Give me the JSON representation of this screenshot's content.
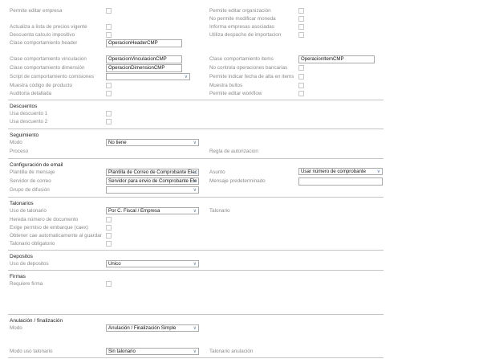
{
  "top": {
    "permite_editar_empresa": "Permite editar empresa",
    "actualiza_lista_precios": "Actualiza a lista de precios vigente",
    "descuenta_calculo_impositivo": "Descuenta calculo impositivo",
    "clase_comportamiento_header": "Clase comportamiento header",
    "clase_comportamiento_header_value": "OperacionHeaderCMP",
    "permite_editar_organizacion": "Permite editar organización",
    "no_permite_modificar_moneda": "No permite modificar moneda",
    "informa_empresas_asociadas": "Informa empresas asociadas",
    "utiliza_despacho_importacion": "Utiliza despacho de importacion"
  },
  "comportamiento": {
    "vinculacion_label": "Clase comportamiento vinculacion",
    "vinculacion_value": "OperacionVinculacionCMP",
    "dimension_label": "Clase comportamiento dimensión",
    "dimension_value": "OperacionDimensionCMP",
    "script_label": "Script de comportamiento comisiones",
    "script_value": "",
    "muestra_codigo_producto": "Muestra código de producto",
    "auditoria_detallada": "Auditoria detallada",
    "items_label": "Clase comportamiento items",
    "items_value": "OperacionItemCMP",
    "no_controla_operaciones_bancarias": "No controla operaciones bancarias",
    "permite_indicar_fecha_alta": "Permite indicar fecha de alta en items",
    "muestra_bultos": "Muestra bultos",
    "permite_editar_workflow": "Permite editar workflow"
  },
  "descuentos": {
    "title": "Descuentos",
    "usa_descuento_1": "Usa descuento 1",
    "usa_descuento_2": "Usa descuento 2"
  },
  "seguimiento": {
    "title": "Seguimiento",
    "modo_label": "Modo",
    "modo_value": "No tiene",
    "proceso_label": "Proceso",
    "regla_autorizacion_label": "Regla de autorizacion"
  },
  "email": {
    "title": "Configuración de email",
    "plantilla_label": "Plantilla de mensaje",
    "plantilla_value": "Plantilla de Correo de Comprobante Elec",
    "servidor_label": "Servidor de correo",
    "servidor_value": "Servidor para envio de Comprobante Ele",
    "grupo_difusion_label": "Grupo de difusión",
    "grupo_difusion_value": "",
    "asunto_label": "Asunto",
    "asunto_value": "Usar número de comprobante",
    "mensaje_predeterminado_label": "Mensaje predeterminado",
    "mensaje_predeterminado_value": ""
  },
  "talonarios": {
    "title": "Talonarios",
    "uso_label": "Uso de talonario",
    "uso_value": "Por C. Fiscal / Empresa",
    "talonario_label": "Talonario",
    "hereda_numero": "Hereda número de documento",
    "exige_permiso_embarque": "Exige permiso de embarque (caex)",
    "obtener_cae": "Obtener cae automaticamente al guardar",
    "talonario_obligatorio": "Talonario obligatorio"
  },
  "depositos": {
    "title": "Depositos",
    "uso_label": "Uso de depositos",
    "uso_value": "Único"
  },
  "firmas": {
    "title": "Firmas",
    "requiere_firma": "Requiere firma"
  },
  "anulacion": {
    "title": "Anulación / finalización",
    "modo_label": "Modo",
    "modo_value": "Anulación / Finalización Simple",
    "modo_uso_talonario_label": "Modo uso talonario",
    "modo_uso_talonario_value": "Sin talonario",
    "talonario_anulacion_label": "Talonario anulación"
  },
  "icons": {
    "dropdown": "chevron-down-icon"
  },
  "colors": {
    "chevron": "#5b7fbd",
    "section_title": "#222222",
    "label": "#8a8a8a"
  }
}
